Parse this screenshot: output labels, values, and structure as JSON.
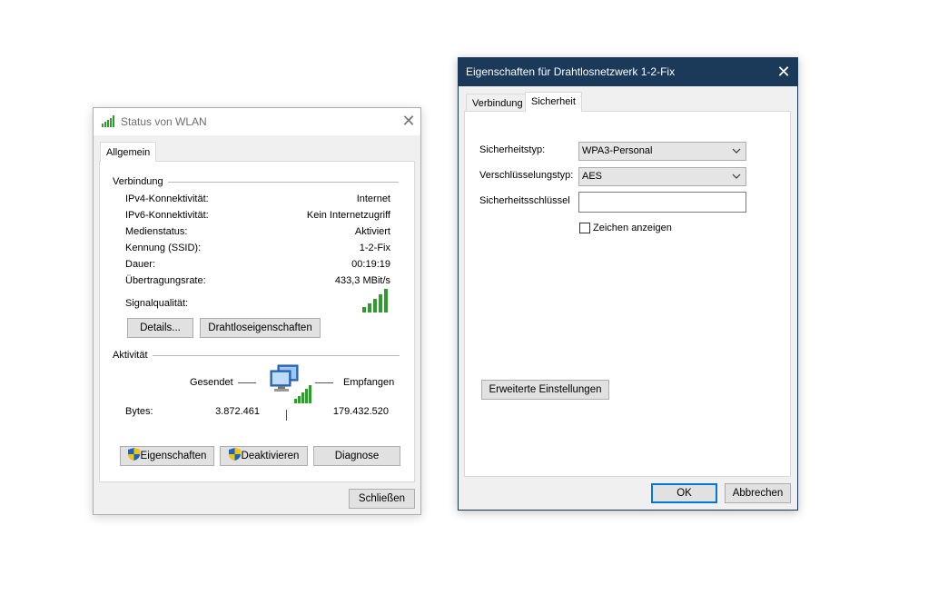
{
  "status_window": {
    "title": "Status von WLAN",
    "close_glyph": "✕",
    "tab": "Allgemein",
    "connection": {
      "group_label": "Verbindung",
      "rows": [
        {
          "label": "IPv4-Konnektivität:",
          "value": "Internet"
        },
        {
          "label": "IPv6-Konnektivität:",
          "value": "Kein Internetzugriff"
        },
        {
          "label": "Medienstatus:",
          "value": "Aktiviert"
        },
        {
          "label": "Kennung (SSID):",
          "value": "1-2-Fix"
        },
        {
          "label": "Dauer:",
          "value": "00:19:19"
        },
        {
          "label": "Übertragungsrate:",
          "value": "433,3 MBit/s"
        }
      ],
      "signal_label": "Signalqualität:",
      "signal_bars": 5,
      "details_button": "Details...",
      "wireless_props_button": "Drahtloseigenschaften"
    },
    "activity": {
      "group_label": "Aktivität",
      "sent_label": "Gesendet",
      "received_label": "Empfangen",
      "bytes_label": "Bytes:",
      "bytes_sent": "3.872.461",
      "bytes_received": "179.432.520"
    },
    "buttons": {
      "properties": "Eigenschaften",
      "disable": "Deaktivieren",
      "diagnose": "Diagnose",
      "close": "Schließen"
    }
  },
  "properties_window": {
    "title": "Eigenschaften für Drahtlosnetzwerk 1-2-Fix",
    "close_glyph": "✕",
    "tabs": [
      "Verbindung",
      "Sicherheit"
    ],
    "active_tab": "Sicherheit",
    "security_type_label": "Sicherheitstyp:",
    "security_type_value": "WPA3-Personal",
    "encryption_type_label": "Verschlüsselungstyp:",
    "encryption_type_value": "AES",
    "security_key_label": "Sicherheitsschlüssel",
    "security_key_value": "",
    "show_chars_label": "Zeichen anzeigen",
    "show_chars_checked": false,
    "advanced_button": "Erweiterte Einstellungen",
    "ok_button": "OK",
    "cancel_button": "Abbrechen"
  },
  "colors": {
    "titlebar_active": "#1b3a59",
    "signal_green": "#2e9c2e",
    "focus_blue": "#0078d7"
  }
}
